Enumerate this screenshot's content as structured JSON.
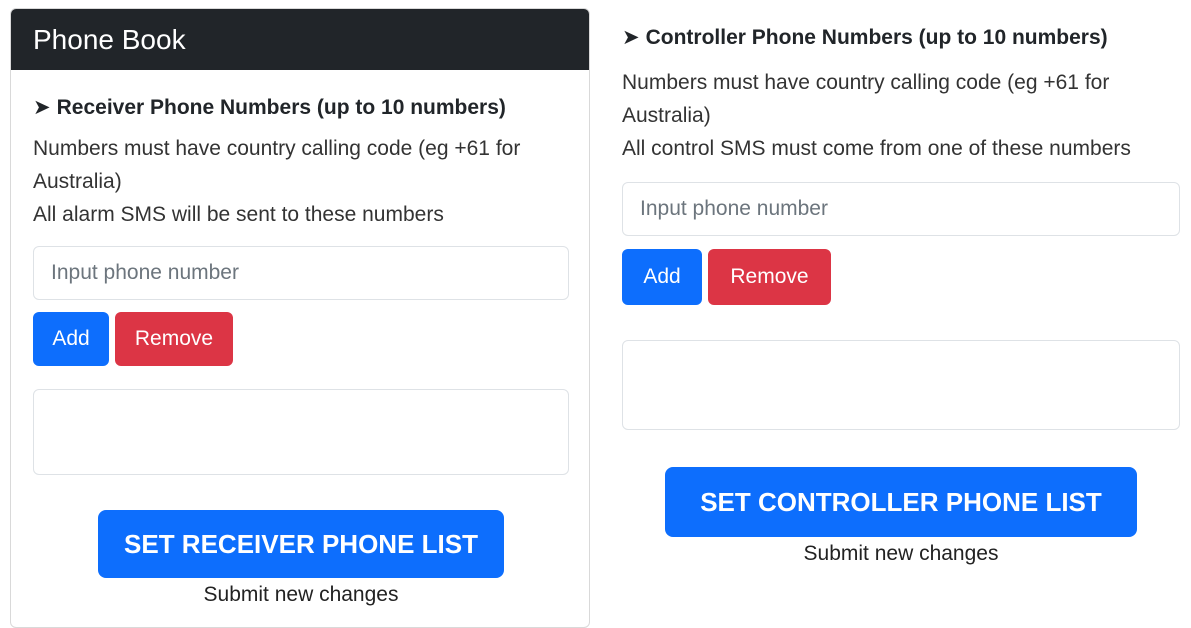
{
  "card": {
    "title": "Phone Book"
  },
  "receiver": {
    "arrow": "➤",
    "heading": "Receiver Phone Numbers (up to 10 numbers)",
    "desc1": "Numbers must have country calling code (eg +61 for Australia)",
    "desc2": "All alarm SMS will be sent to these numbers",
    "input_placeholder": "Input phone number",
    "add_label": "Add",
    "remove_label": "Remove",
    "submit_label": "SET RECEIVER PHONE LIST",
    "submit_note": "Submit new changes"
  },
  "controller": {
    "arrow": "➤",
    "heading": "Controller Phone Numbers (up to 10 numbers)",
    "desc1": "Numbers must have country calling code (eg +61 for Australia)",
    "desc2": "All control SMS must come from one of these numbers",
    "input_placeholder": "Input phone number",
    "add_label": "Add",
    "remove_label": "Remove",
    "submit_label": "SET CONTROLLER PHONE LIST",
    "submit_note": "Submit new changes"
  },
  "colors": {
    "header_bg": "#212529",
    "primary": "#0d6efd",
    "danger": "#dc3545"
  }
}
